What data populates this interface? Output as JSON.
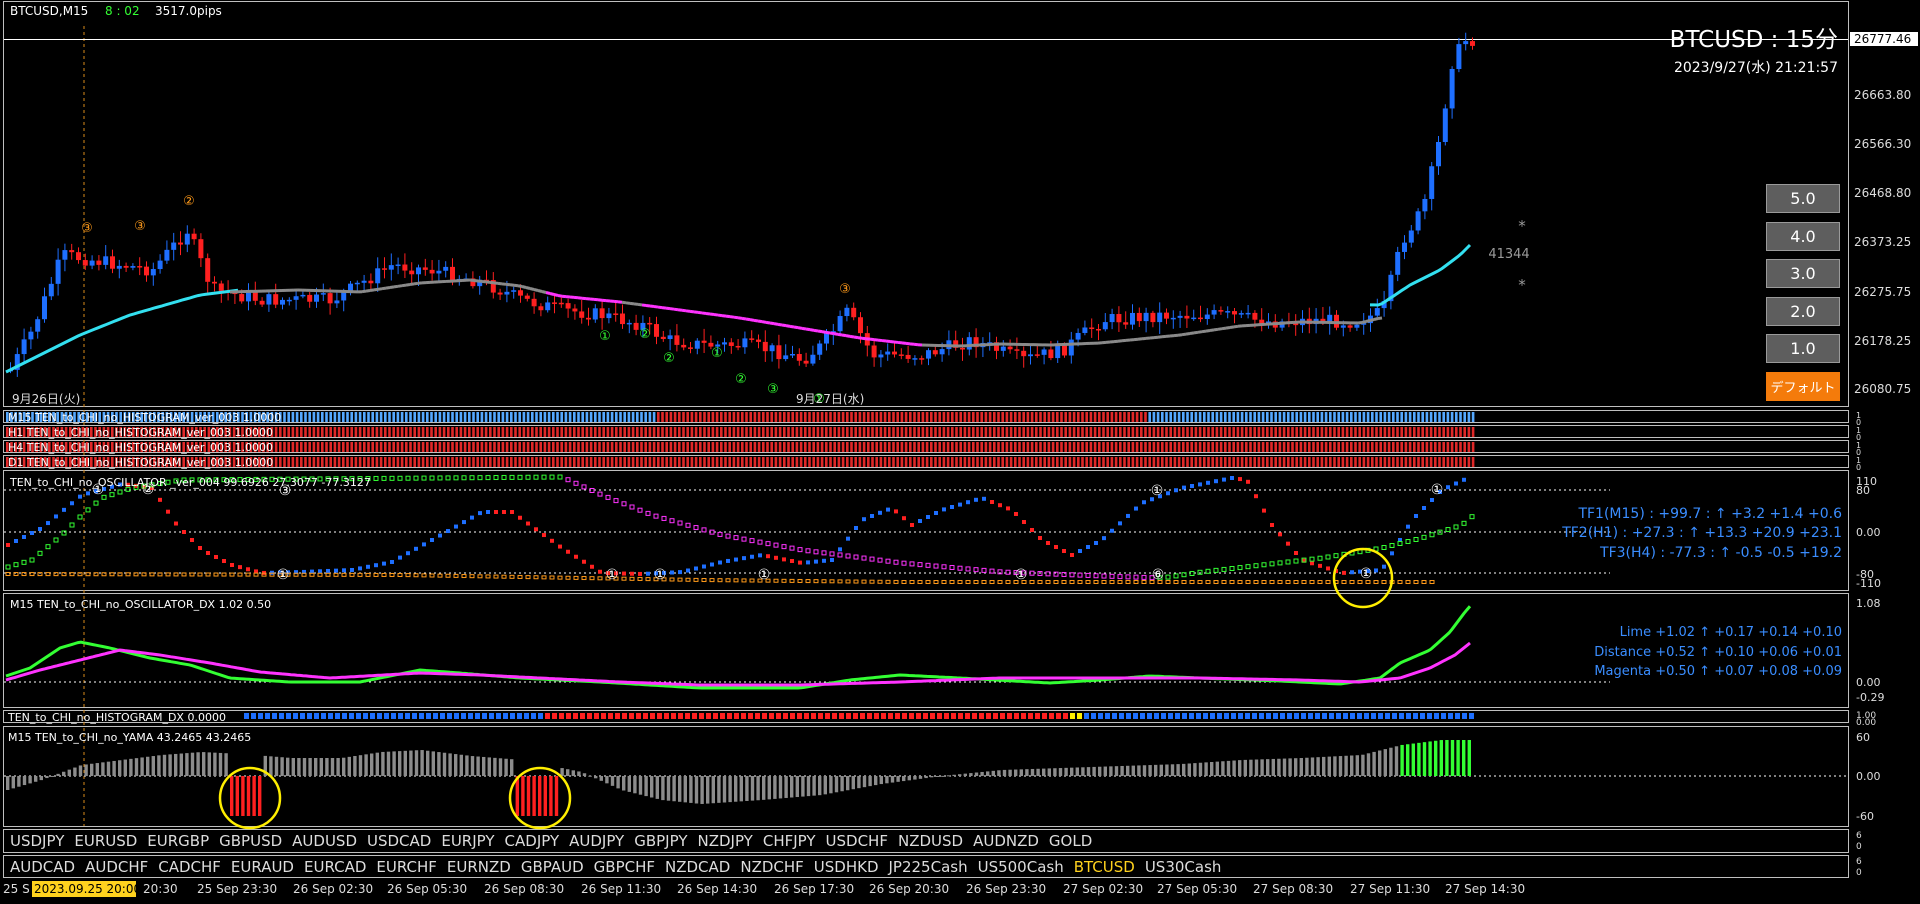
{
  "chart": {
    "symbol_tf": "BTCUSD,M15",
    "countdown": "8 : 02",
    "pips": "3517.0pips",
    "big_title": "BTCUSD : 15分",
    "datetime": "2023/9/27(水) 21:21:57",
    "current_price": "26777.46",
    "price_ticks": [
      "26663.80",
      "26566.30",
      "26468.80",
      "26373.25",
      "26275.75",
      "26178.25",
      "26080.75"
    ],
    "day_label_1": "9月26日(火)",
    "day_label_2": "9月27日(水)",
    "side_value": "41344",
    "star_1": "*",
    "star_2": "*"
  },
  "markers": {
    "orange": [
      "③",
      "③",
      "②"
    ],
    "green": [
      "①",
      "②",
      "②",
      "①",
      "②",
      "③",
      "①"
    ]
  },
  "tf_buttons": [
    "5.0",
    "4.0",
    "3.0",
    "2.0",
    "1.0",
    "デフォルト"
  ],
  "histogram_labels": [
    "M15 TEN_to_CHI_no_HISTOGRAM_ver_003 1.0000",
    "H1 TEN_to_CHI_no_HISTOGRAM_ver_003 1.0000",
    "H4 TEN_to_CHI_no_HISTOGRAM_ver_003 1.0000",
    "D1 TEN_to_CHI_no_HISTOGRAM_ver_003 1.0000"
  ],
  "hist_scale": [
    "1",
    "0",
    "1",
    "0",
    "1",
    "0",
    "1",
    "0"
  ],
  "oscillator": {
    "label": "TEN_to_CHI_no_OSCILLATOR _ver_004 99.6926 27.3077 -77.3127",
    "axis": [
      "110",
      "80",
      "0.00",
      "-80",
      "-110"
    ],
    "tf1": "TF1(M15) : +99.7 : ↑ +3.2 +1.4 +0.6",
    "tf2": "TF2(H1) : +27.3 : ↑ +13.3 +20.9 +23.1",
    "tf3": "TF3(H4) : -77.3 : ↑ -0.5 -0.5 +19.2",
    "circled": [
      "①",
      "②",
      "③",
      "①",
      "①",
      "①",
      "①",
      "①",
      "⑥",
      "①",
      "①"
    ]
  },
  "dx": {
    "label": "M15 TEN_to_CHI_no_OSCILLATOR_DX 1.02 0.50",
    "axis": [
      "1.08",
      "0.00",
      "-0.29"
    ],
    "lime": "Lime +1.02 ↑ +0.17 +0.14 +0.10",
    "distance": "Distance +0.52 ↑ +0.10 +0.06 +0.01",
    "magenta": "Magenta +0.50 ↑ +0.07 +0.08 +0.09"
  },
  "hist_dx": {
    "label": "TEN_to_CHI_no_HISTOGRAM_DX 0.0000",
    "axis": [
      "1.00",
      "0.00"
    ]
  },
  "yama": {
    "label": "M15 TEN_to_CHI_no_YAMA 43.2465 43.2465",
    "axis": [
      "60",
      "0.00",
      "-60"
    ]
  },
  "symbols_row1": [
    "USDJPY",
    "EURUSD",
    "EURGBP",
    "GBPUSD",
    "AUDUSD",
    "USDCAD",
    "EURJPY",
    "CADJPY",
    "AUDJPY",
    "GBPJPY",
    "NZDJPY",
    "CHFJPY",
    "USDCHF",
    "NZDUSD",
    "AUDNZD",
    "GOLD"
  ],
  "symbols_row2": [
    "AUDCAD",
    "AUDCHF",
    "CADCHF",
    "EURAUD",
    "EURCAD",
    "EURCHF",
    "EURNZD",
    "GBPAUD",
    "GBPCHF",
    "NZDCAD",
    "NZDCHF",
    "USDHKD",
    "JP225Cash",
    "US500Cash",
    "BTCUSD",
    "US30Cash"
  ],
  "symbols_row2_active": "BTCUSD",
  "sym_scale_1": [
    "6",
    "0"
  ],
  "sym_scale_2": [
    "6",
    "0"
  ],
  "time_axis": {
    "first": "25 S",
    "highlight": "2023.09.25 20:00",
    "labels": [
      "20:30",
      "25 Sep 23:30",
      "26 Sep 02:30",
      "26 Sep 05:30",
      "26 Sep 08:30",
      "26 Sep 11:30",
      "26 Sep 14:30",
      "26 Sep 17:30",
      "26 Sep 20:30",
      "26 Sep 23:30",
      "27 Sep 02:30",
      "27 Sep 05:30",
      "27 Sep 08:30",
      "27 Sep 11:30",
      "27 Sep 14:30"
    ]
  },
  "colors": {
    "bull": "#1e6fff",
    "bear": "#ff2020",
    "cyan": "#33e0f0",
    "magenta": "#ff33ff",
    "lime": "#33ff33",
    "hist_blue": "#55a8ff",
    "hist_red": "#e02828",
    "info_blue": "#3a8dff",
    "orange": "#ff9a1a",
    "yellow": "#ffee00",
    "highlight_bg": "#ffd21e"
  }
}
